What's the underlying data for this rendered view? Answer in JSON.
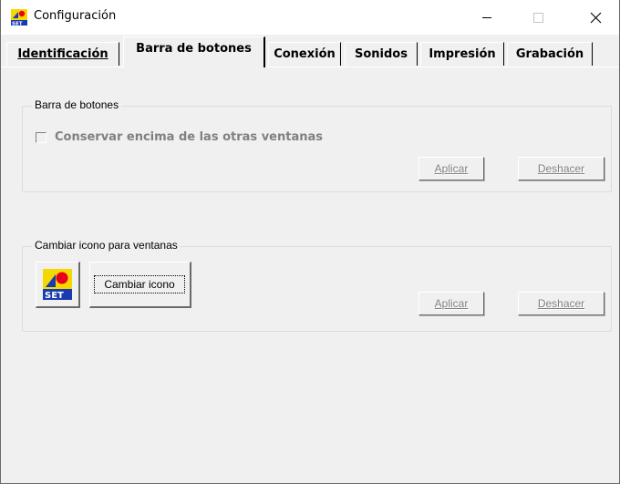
{
  "window": {
    "title": "Configuración",
    "app_icon": "set-logo-icon",
    "controls": {
      "minimize": "minimize-icon",
      "maximize": "maximize-icon",
      "close": "close-icon"
    }
  },
  "tabs": [
    {
      "label": "Identificación",
      "active": false
    },
    {
      "label": "Barra de botones",
      "active": true
    },
    {
      "label": "Conexión",
      "active": false
    },
    {
      "label": "Sonidos",
      "active": false
    },
    {
      "label": "Impresión",
      "active": false
    },
    {
      "label": "Grabación",
      "active": false
    }
  ],
  "toolbar_group": {
    "label": "Barra de botones",
    "checkbox_label": "Conservar encima de las otras ventanas",
    "checked": false,
    "apply_label": "Aplicar",
    "undo_label": "Deshacer"
  },
  "icon_group": {
    "label": "Cambiar icono para ventanas",
    "current_icon": "set-logo-icon",
    "change_label": "Cambiar icono",
    "apply_label": "Aplicar",
    "undo_label": "Deshacer"
  },
  "colors": {
    "face": "#f0f0f0",
    "disabled_text": "#808080",
    "logo_yellow": "#f5d800",
    "logo_red": "#e8001c",
    "logo_blue": "#1a3bb0"
  }
}
